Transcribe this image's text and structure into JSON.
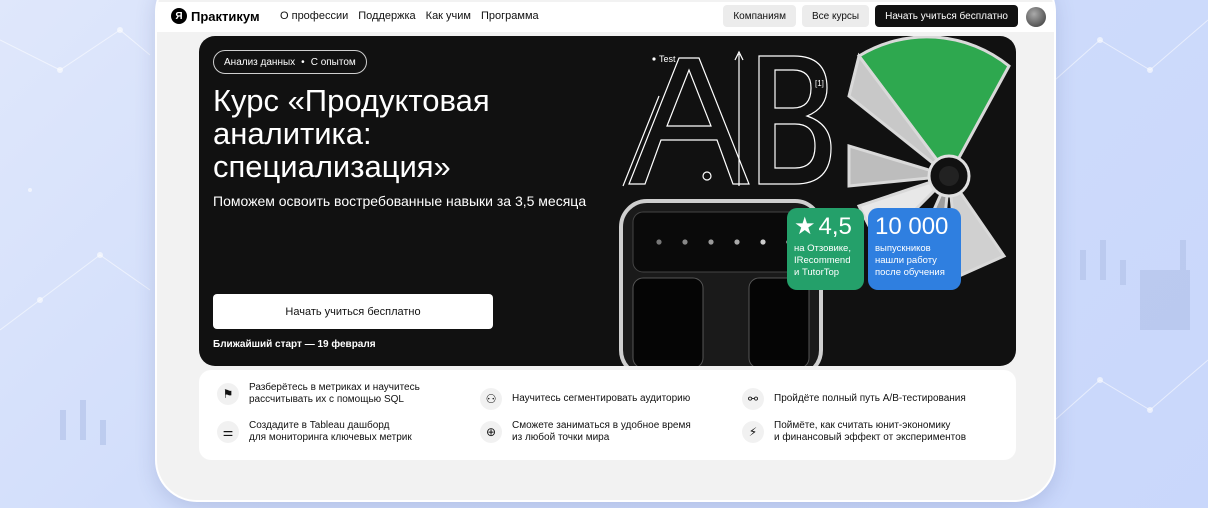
{
  "header": {
    "logo_text": "Практикум",
    "nav": [
      "О профессии",
      "Поддержка",
      "Как учим",
      "Программа"
    ],
    "buttons": {
      "companies": "Компаниям",
      "all_courses": "Все курсы",
      "start_free": "Начать учиться бесплатно"
    }
  },
  "hero": {
    "tags": [
      "Анализ данных",
      "С опытом"
    ],
    "title": "Курс «Продуктовая аналитика: специализация»",
    "subtitle": "Поможем освоить востребованные навыки за 3,5 месяца",
    "cta": "Начать учиться бесплатно",
    "start_date": "Ближайший старт — 19 февраля",
    "art": {
      "test_label": "Test",
      "letters": "AB",
      "note": "[1]"
    }
  },
  "badges": {
    "rating": {
      "value": "4,5",
      "line1": "на Отзовике,",
      "line2": "IRecommend",
      "line3": "и TutorTop",
      "icon": "star-icon"
    },
    "graduates": {
      "value": "10 000",
      "line1": "выпускников",
      "line2": "нашли работу",
      "line3": "после обучения"
    }
  },
  "features": [
    {
      "icon": "flag-icon",
      "line1": "Разберётесь в метриках и научитесь",
      "line2": "рассчитывать их с помощью SQL"
    },
    {
      "icon": "add-user-icon",
      "line1": "Научитесь сегментировать аудиторию",
      "line2": ""
    },
    {
      "icon": "link-icon",
      "line1": "Пройдёте полный путь A/B-тестирования",
      "line2": ""
    },
    {
      "icon": "sliders-icon",
      "line1": "Создадите в Tableau дашборд",
      "line2": "для мониторинга ключевых метрик"
    },
    {
      "icon": "globe-icon",
      "line1": "Сможете заниматься в удобное время",
      "line2": "из любой точки мира"
    },
    {
      "icon": "lightning-icon",
      "line1": "Поймёте, как считать юнит-экономику",
      "line2": "и финансовый эффект от экспериментов"
    }
  ],
  "colors": {
    "hero_bg": "#111111",
    "green_badge": "#24a06a",
    "blue_badge": "#2f7fe0"
  }
}
